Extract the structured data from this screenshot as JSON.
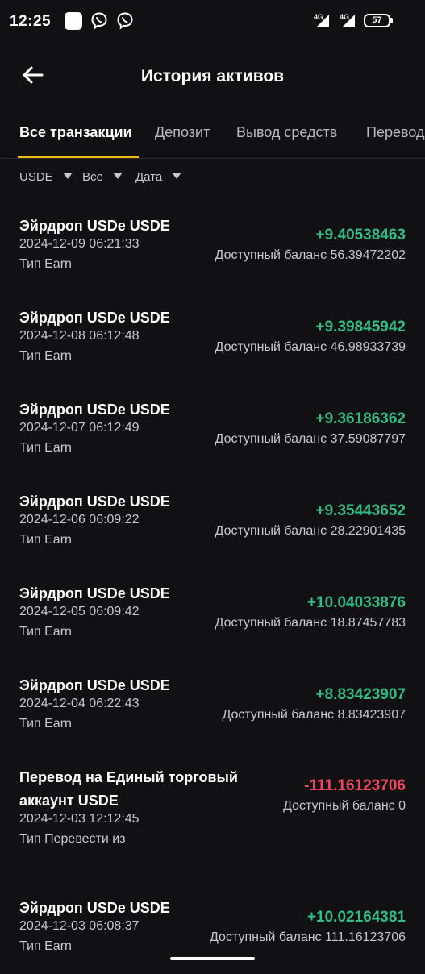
{
  "status_bar": {
    "time": "12:25",
    "network_1": "4G",
    "network_2": "4G",
    "battery": "57"
  },
  "header": {
    "title": "История активов",
    "back_icon": "arrow-left-icon"
  },
  "tabs": [
    "Все транзакции",
    "Депозит",
    "Вывод средств",
    "Перевод"
  ],
  "filters": [
    "USDE",
    "Все",
    "Дата"
  ],
  "colors": {
    "positive": "#2ebd85",
    "negative": "#f6465d",
    "accent": "#f0b90b"
  },
  "transactions": [
    {
      "title": "Эйрдроп USDe  USDE",
      "date": "2024-12-09 06:21:33",
      "type": "Тип Earn",
      "amount": "+9.40538463",
      "balance": "Доступный баланс 56.39472202",
      "direction": "in"
    },
    {
      "title": "Эйрдроп USDe  USDE",
      "date": "2024-12-08 06:12:48",
      "type": "Тип Earn",
      "amount": "+9.39845942",
      "balance": "Доступный баланс 46.98933739",
      "direction": "in"
    },
    {
      "title": "Эйрдроп USDe  USDE",
      "date": "2024-12-07 06:12:49",
      "type": "Тип Earn",
      "amount": "+9.36186362",
      "balance": "Доступный баланс 37.59087797",
      "direction": "in"
    },
    {
      "title": "Эйрдроп USDe  USDE",
      "date": "2024-12-06 06:09:22",
      "type": "Тип Earn",
      "amount": "+9.35443652",
      "balance": "Доступный баланс 28.22901435",
      "direction": "in"
    },
    {
      "title": "Эйрдроп USDe  USDE",
      "date": "2024-12-05 06:09:42",
      "type": "Тип Earn",
      "amount": "+10.04033876",
      "balance": "Доступный баланс 18.87457783",
      "direction": "in"
    },
    {
      "title": "Эйрдроп USDe  USDE",
      "date": "2024-12-04 06:22:43",
      "type": "Тип Earn",
      "amount": "+8.83423907",
      "balance": "Доступный баланс 8.83423907",
      "direction": "in"
    },
    {
      "title": "Перевод на Единый торговый аккаунт USDE",
      "date": "2024-12-03 12:12:45",
      "type": "Тип Перевести из",
      "amount": "-111.16123706",
      "balance": "Доступный баланс 0",
      "direction": "out"
    },
    {
      "title": "Эйрдроп USDe  USDE",
      "date": "2024-12-03 06:08:37",
      "type": "Тип Earn",
      "amount": "+10.02164381",
      "balance": "Доступный баланс 111.16123706",
      "direction": "in"
    }
  ]
}
